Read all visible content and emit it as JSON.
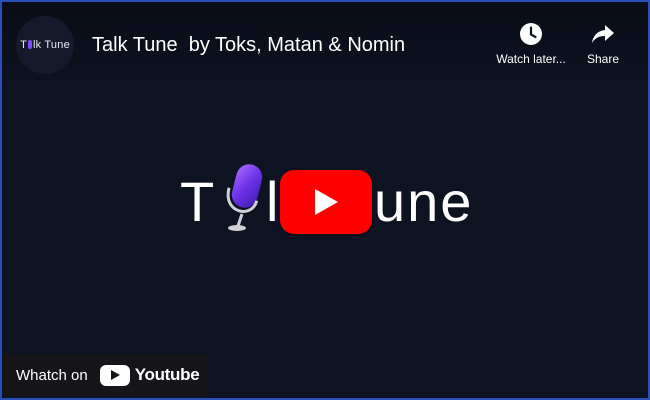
{
  "video": {
    "title": "Talk Tune  by Toks, Matan & Nomin",
    "channel_avatar_text_left": "T",
    "channel_avatar_text_right": "lk Tune"
  },
  "actions": {
    "watch_later_label": "Watch later...",
    "share_label": "Share"
  },
  "thumbnail": {
    "logo_left": "T",
    "logo_middle": "l",
    "logo_right": "une"
  },
  "watch_on": {
    "prefix": "Whatch on",
    "brand": "Youtube"
  },
  "colors": {
    "background": "#0e1322",
    "border": "#2a4fb8",
    "play_button": "#ff0000",
    "mic_purple": "#7b4cff"
  },
  "icons": {
    "watch_later": "clock-icon",
    "share": "share-arrow-icon",
    "play": "play-icon",
    "mic": "microphone-icon",
    "youtube": "youtube-logo-icon"
  }
}
